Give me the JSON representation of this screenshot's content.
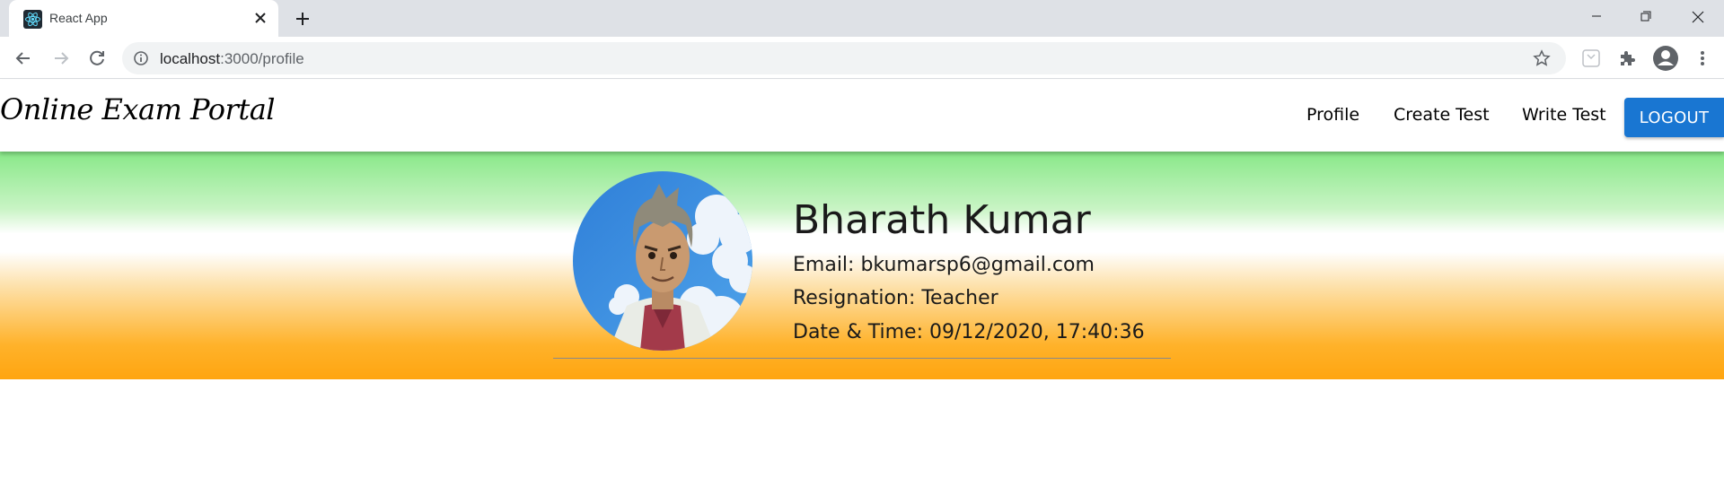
{
  "browser": {
    "tab_title": "React App",
    "url_host": "localhost",
    "url_rest": ":3000/profile"
  },
  "navbar": {
    "brand": "Online Exam Portal",
    "links": [
      "Profile",
      "Create Test",
      "Write Test"
    ],
    "logout_label": "LOGOUT",
    "logout_color": "#1976d2"
  },
  "profile": {
    "name": "Bharath Kumar",
    "email_line": "Email: bkumarsp6@gmail.com",
    "role_line": "Resignation: Teacher",
    "datetime_line": "Date & Time: 09/12/2020, 17:40:36"
  },
  "icons": [
    "react-favicon-icon",
    "close-icon",
    "plus-icon",
    "minimize-icon",
    "restore-icon",
    "window-close-icon",
    "back-arrow-icon",
    "forward-arrow-icon",
    "reload-icon",
    "info-icon",
    "star-icon",
    "extension-puzzle-icon",
    "account-icon",
    "more-vert-icon"
  ]
}
